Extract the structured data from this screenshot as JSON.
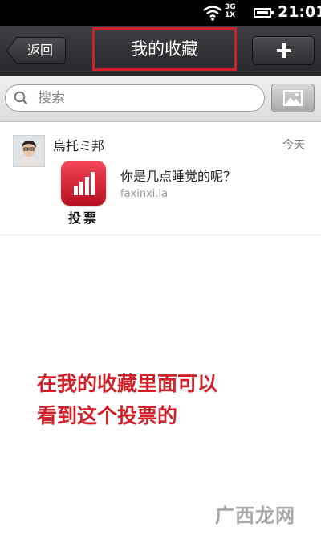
{
  "status_bar": {
    "network_top": "3G",
    "network_bottom": "1X",
    "time": "21:01"
  },
  "header": {
    "back_label": "返回",
    "title": "我的收藏",
    "add_icon": "plus-icon"
  },
  "search": {
    "placeholder": "搜索",
    "icon": "search-icon",
    "image_button_icon": "image-icon"
  },
  "favorites": [
    {
      "user": "烏托ミ邦",
      "time": "今天",
      "app_label": "投票",
      "title": "你是几点睡觉的呢？",
      "source": "faxinxi.la"
    }
  ],
  "annotation": {
    "line1": "在我的收藏里面可以",
    "line2": "看到这个投票的"
  },
  "watermark": {
    "text": "广西龙网"
  },
  "colors": {
    "accent_red": "#d0202a",
    "titlebar": "#2f3134",
    "app_icon": "#e8283a"
  }
}
